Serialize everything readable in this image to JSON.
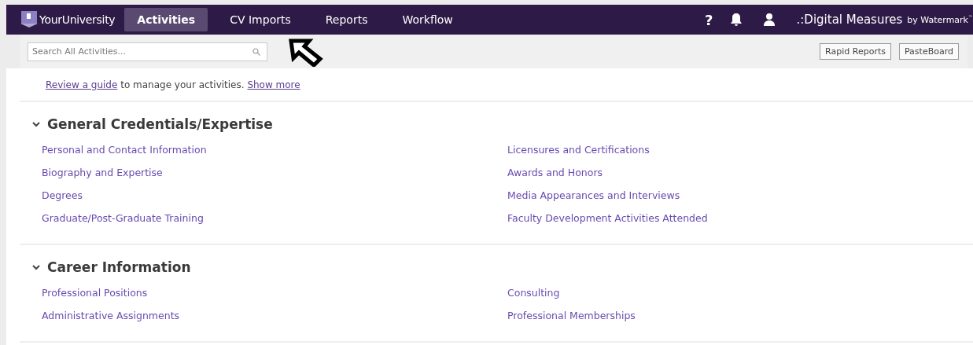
{
  "nav": {
    "brand": "YourUniversity",
    "tabs": [
      {
        "label": "Activities",
        "selected": true
      },
      {
        "label": "CV Imports",
        "selected": false
      },
      {
        "label": "Reports",
        "selected": false
      },
      {
        "label": "Workflow",
        "selected": false
      }
    ],
    "help": "?",
    "vendor": ".:Digital Measures",
    "vendor_by": "by Watermark",
    "vendor_tm": "™"
  },
  "toolbar": {
    "search": {
      "placeholder": "Search All Activities..."
    },
    "buttons": [
      "Rapid Reports",
      "PasteBoard"
    ]
  },
  "intro": {
    "link": "Review a guide",
    "text": " to manage your activities. ",
    "more": "Show more"
  },
  "sections": [
    {
      "title": "General Credentials/Expertise",
      "expanded": true,
      "items": [
        "Personal and Contact Information",
        "Biography and Expertise",
        "Degrees",
        "Graduate/Post-Graduate Training",
        "Licensures and Certifications",
        "Awards and Honors",
        "Media Appearances and Interviews",
        "Faculty Development Activities Attended"
      ]
    },
    {
      "title": "Career Information",
      "expanded": true,
      "items": [
        "Professional Positions",
        "Administrative Assignments",
        "Consulting",
        "Professional Memberships"
      ]
    }
  ]
}
